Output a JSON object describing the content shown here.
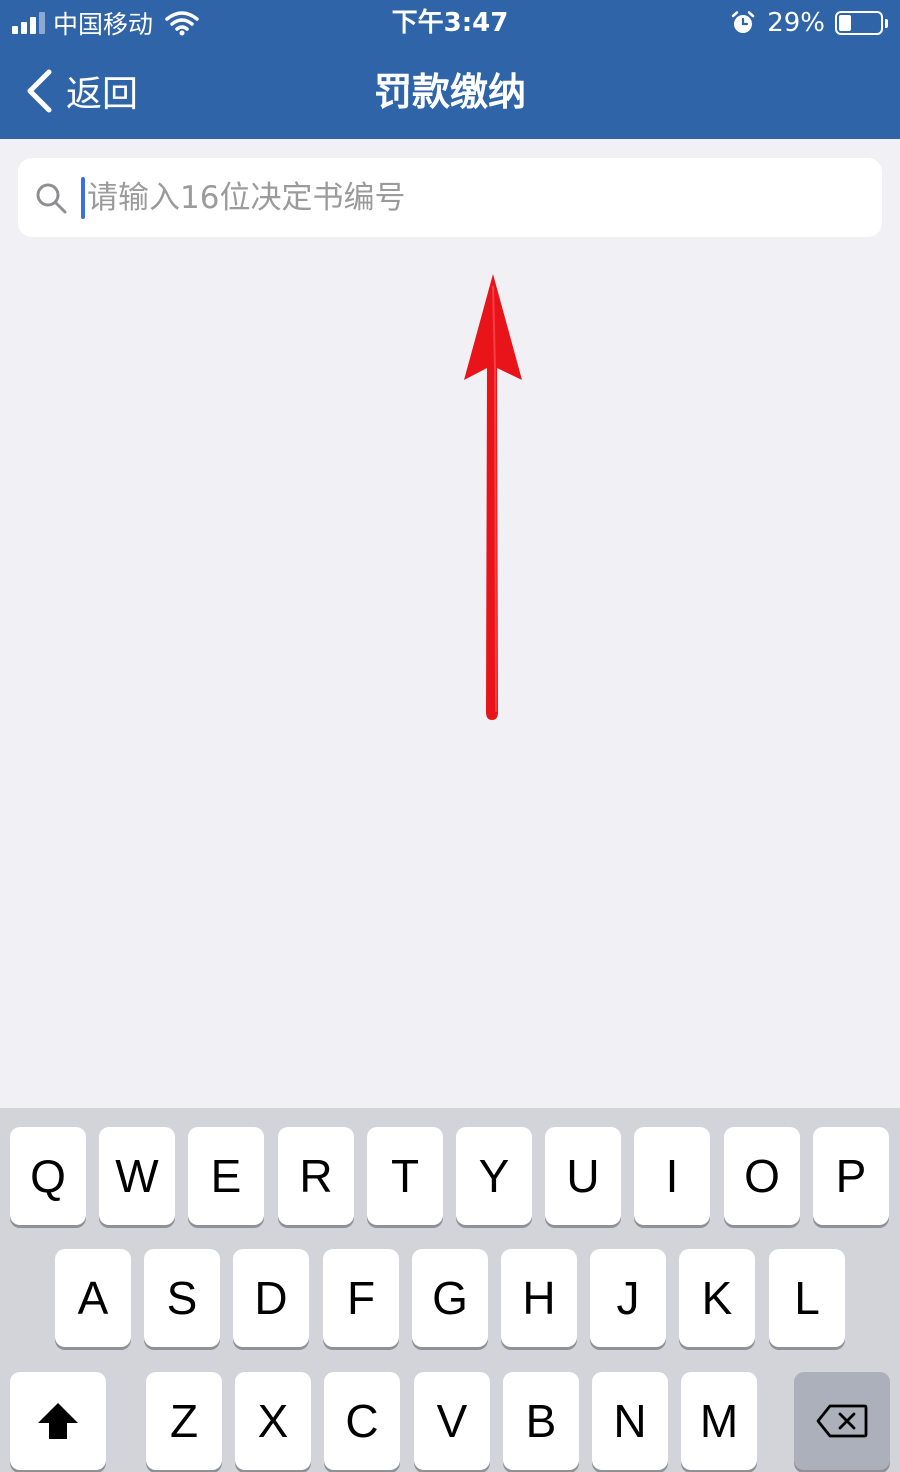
{
  "status_bar": {
    "carrier": "中国移动",
    "time": "下午3:47",
    "battery_percent": "29%",
    "battery_level": 0.29
  },
  "nav": {
    "back_label": "返回",
    "title": "罚款缴纳"
  },
  "search": {
    "placeholder": "请输入16位决定书编号",
    "value": ""
  },
  "colors": {
    "header_bg": "#2f65a8",
    "page_bg": "#f1f1f5",
    "arrow": "#e8141a",
    "keyboard_bg": "#d2d4da"
  },
  "keyboard": {
    "row1": [
      "Q",
      "W",
      "E",
      "R",
      "T",
      "Y",
      "U",
      "I",
      "O",
      "P"
    ],
    "row2": [
      "A",
      "S",
      "D",
      "F",
      "G",
      "H",
      "J",
      "K",
      "L"
    ],
    "row3": [
      "Z",
      "X",
      "C",
      "V",
      "B",
      "N",
      "M"
    ],
    "shift_icon": "shift-arrow-icon",
    "delete_icon": "backspace-icon"
  }
}
